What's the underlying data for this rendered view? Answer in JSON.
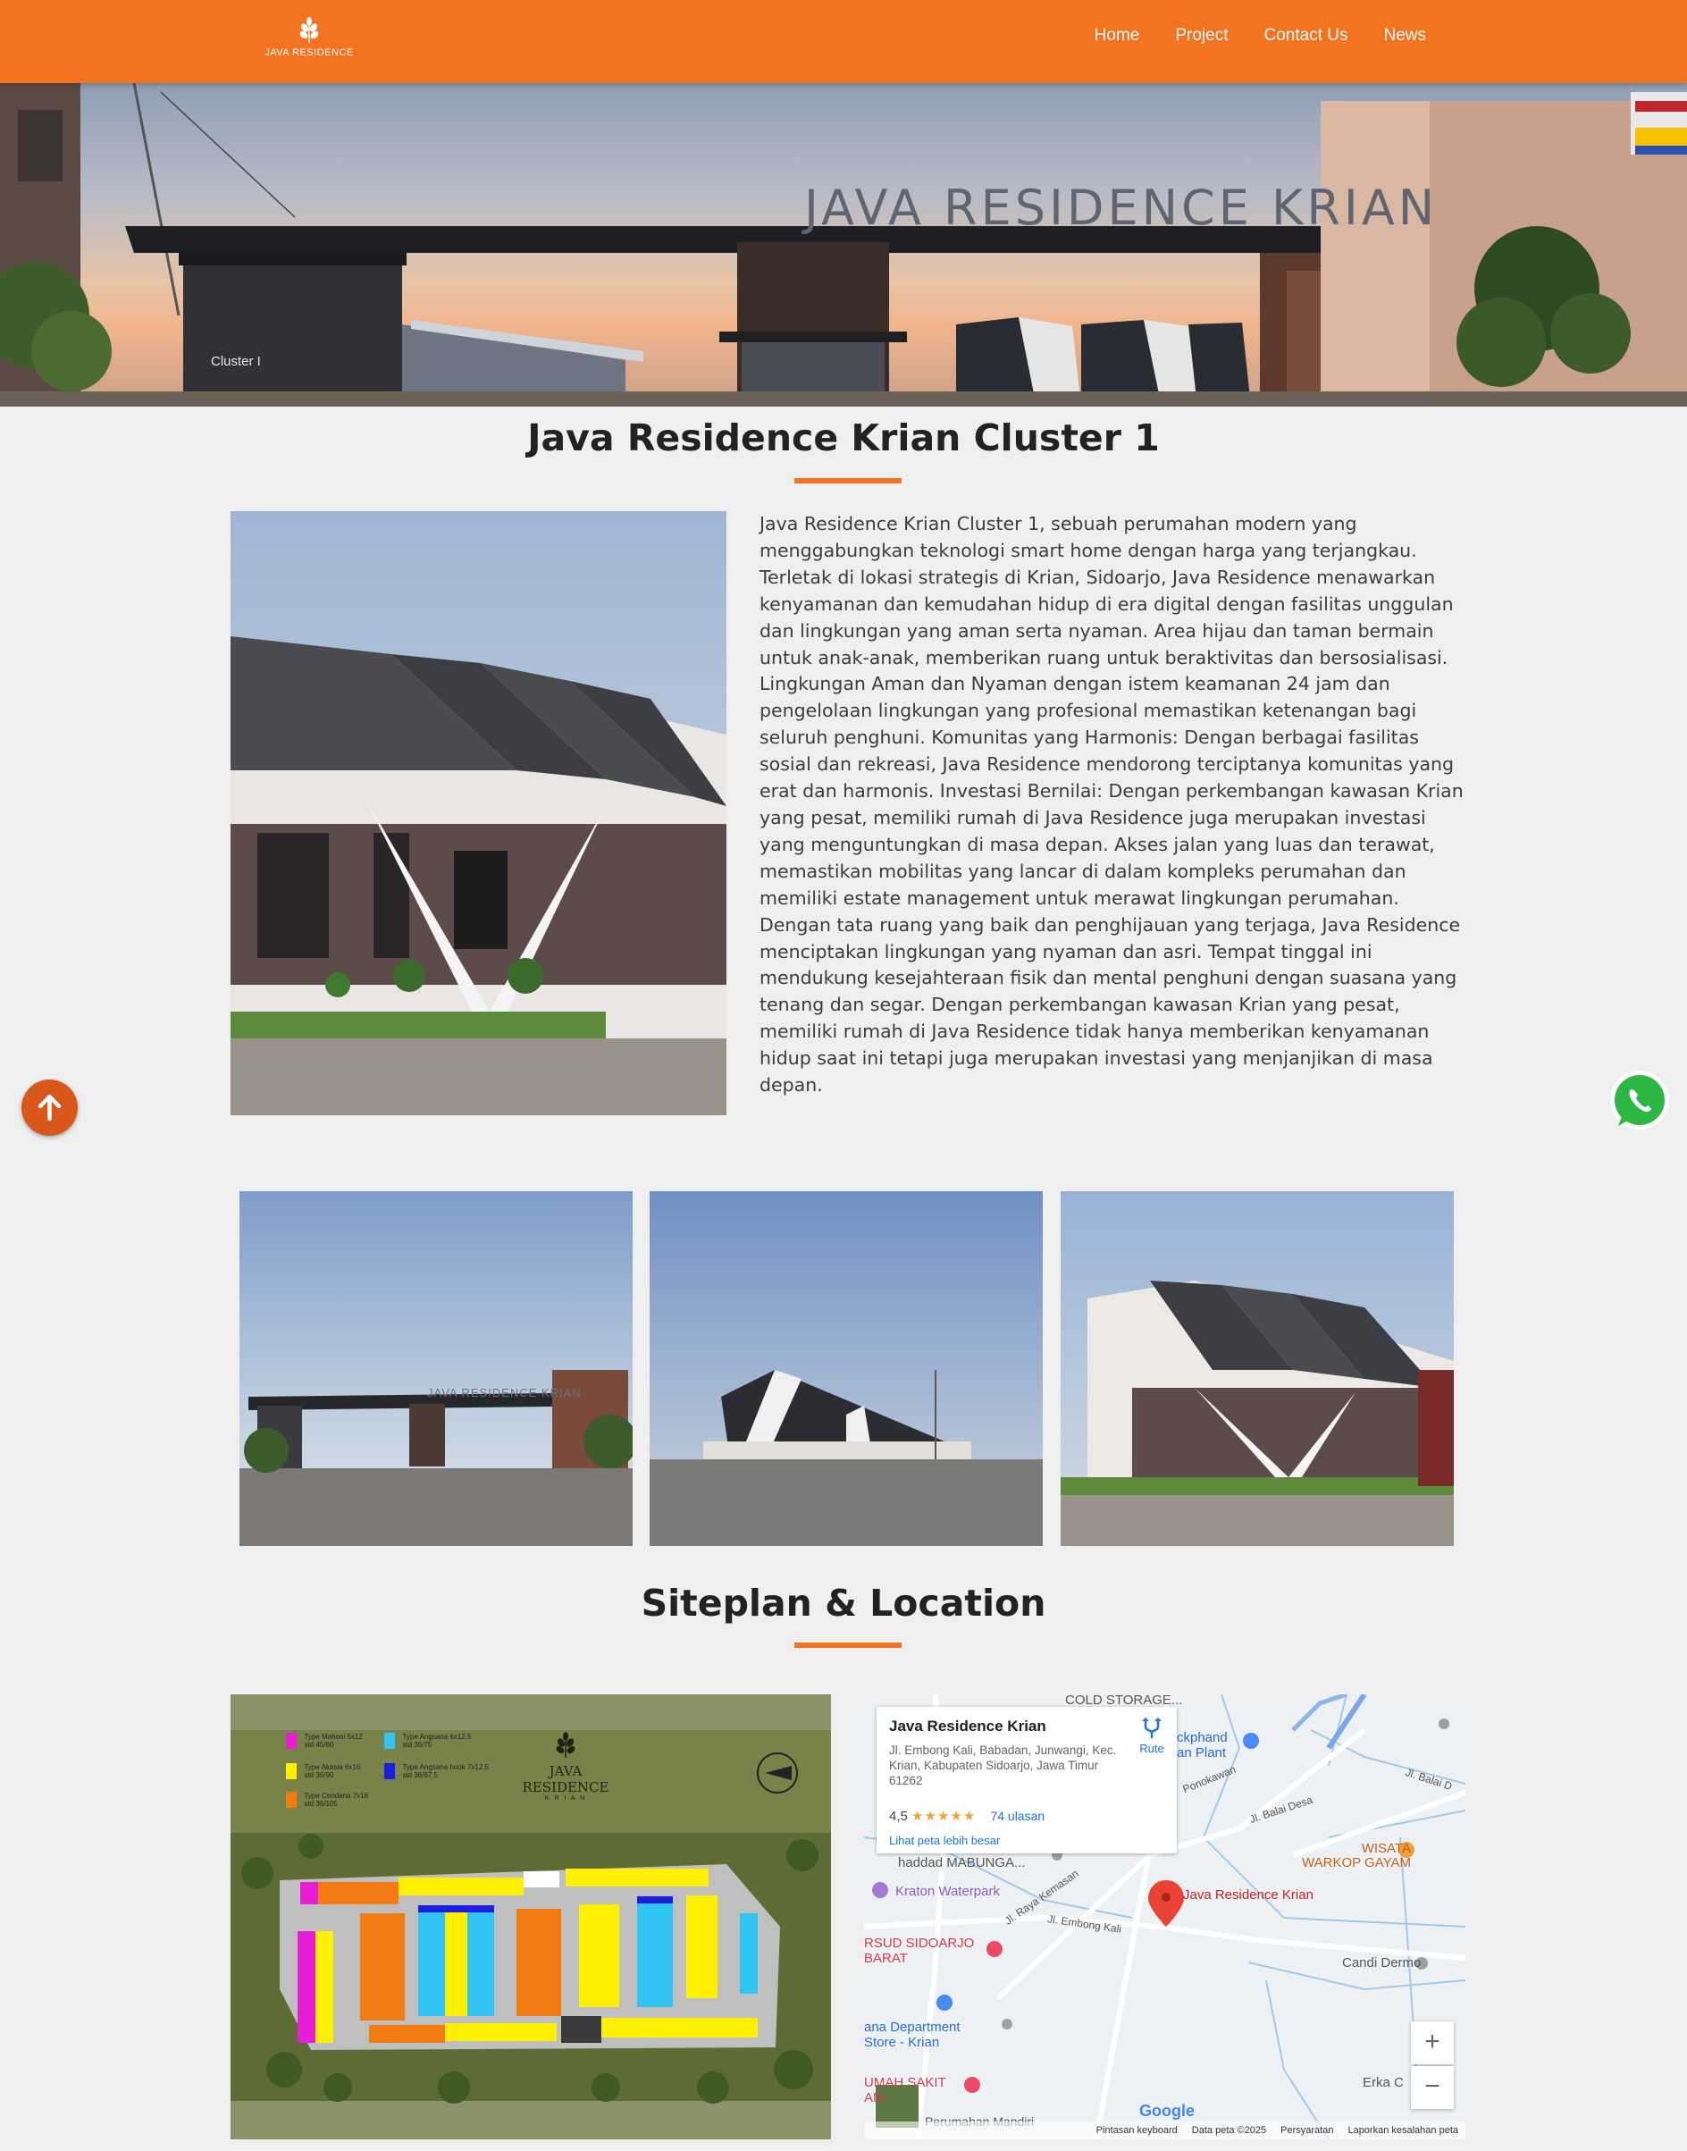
{
  "header": {
    "logo_text": "JAVA RESIDENCE",
    "nav": [
      "Home",
      "Project",
      "Contact Us",
      "News"
    ]
  },
  "hero": {
    "sign_text": "JAVA RESIDENCE KRIAN",
    "cluster_label": "Cluster I"
  },
  "cluster": {
    "title": "Java Residence Krian Cluster 1",
    "description": "Java Residence Krian Cluster 1, sebuah perumahan modern yang menggabungkan teknologi smart home dengan harga yang terjangkau. Terletak di lokasi strategis di Krian, Sidoarjo, Java Residence menawarkan kenyamanan dan kemudahan hidup di era digital dengan fasilitas unggulan dan lingkungan yang aman serta nyaman. Area hijau dan taman bermain untuk anak-anak, memberikan ruang untuk beraktivitas dan bersosialisasi. Lingkungan Aman dan Nyaman dengan istem keamanan 24 jam dan pengelolaan lingkungan yang profesional memastikan ketenangan bagi seluruh penghuni. Komunitas yang Harmonis: Dengan berbagai fasilitas sosial dan rekreasi, Java Residence mendorong terciptanya komunitas yang erat dan harmonis. Investasi Bernilai: Dengan perkembangan kawasan Krian yang pesat, memiliki rumah di Java Residence juga merupakan investasi yang menguntungkan di masa depan. Akses jalan yang luas dan terawat, memastikan mobilitas yang lancar di dalam kompleks perumahan dan memiliki estate management untuk merawat lingkungan perumahan. Dengan tata ruang yang baik dan penghijauan yang terjaga, Java Residence menciptakan lingkungan yang nyaman dan asri. Tempat tinggal ini mendukung kesejahteraan fisik dan mental penghuni dengan suasana yang tenang dan segar. Dengan perkembangan kawasan Krian yang pesat, memiliki rumah di Java Residence tidak hanya memberikan kenyamanan hidup saat ini tetapi juga merupakan investasi yang menjanjikan di masa depan.",
    "gallery_sign": "JAVA RESIDENCE KRIAN"
  },
  "siteplan": {
    "title": "Siteplan & Location",
    "brand": "JAVA RESIDENCE",
    "brand_sub": "K R I A N",
    "legend": [
      {
        "label": "Type Mahoni 5x12",
        "sub": "std 45/60",
        "color": "#e81ed6"
      },
      {
        "label": "Type Akasia 6x16",
        "sub": "std 36/90",
        "color": "#ffef00"
      },
      {
        "label": "Type Cendana 7x16",
        "sub": "std 36/105",
        "color": "#f47a12"
      },
      {
        "label": "Type Angsana 6x12.5",
        "sub": "std 36/75",
        "color": "#31c4f2"
      },
      {
        "label": "Type Angsana hook 7x12.5",
        "sub": "std 36/87.5",
        "color": "#1b1fe0"
      }
    ]
  },
  "map": {
    "place_name": "Java Residence Krian",
    "address": "Jl. Embong Kali, Babadan, Junwangi, Kec. Krian, Kabupaten Sidoarjo, Jawa Timur 61262",
    "rating": "4,5",
    "stars": "★★★★★",
    "reviews": "74 ulasan",
    "larger_map": "Lihat peta lebih besar",
    "route": "Rute",
    "labels": {
      "cold_storage": "COLD STORAGE...",
      "ice_plant": "ckphand\nan Plant",
      "ponokawan": "Ponokawan",
      "balai_desa": "Jl. Balai Desa",
      "balai_d": "Jl. Balai D",
      "wisata": "WISATA\nWARKOP GAYAM",
      "masjid": "haddad MABUNGA...",
      "kraton": "Kraton Waterpark",
      "raya_kemasan": "Jl. Raya Kemasan",
      "embong_kali": "Jl. Embong Kali",
      "marker": "Java Residence Krian",
      "rsud": "RSUD SIDOARJO\nBARAT",
      "candi_dermo": "Candi Dermo",
      "ramayana": "ana Department\nStore - Krian",
      "rs_umah": "UMAH SAKIT\nAM...",
      "erka": "Erka C",
      "perumahan": "Perumahan Mandiri"
    },
    "google": "Google",
    "footer": [
      "Pintasan keyboard",
      "Data peta ©2025",
      "Persyaratan",
      "Laporkan kesalahan peta"
    ]
  },
  "colors": {
    "brand": "#f47320",
    "scroll_top": "#d8571a",
    "whatsapp": "#2cb742"
  }
}
